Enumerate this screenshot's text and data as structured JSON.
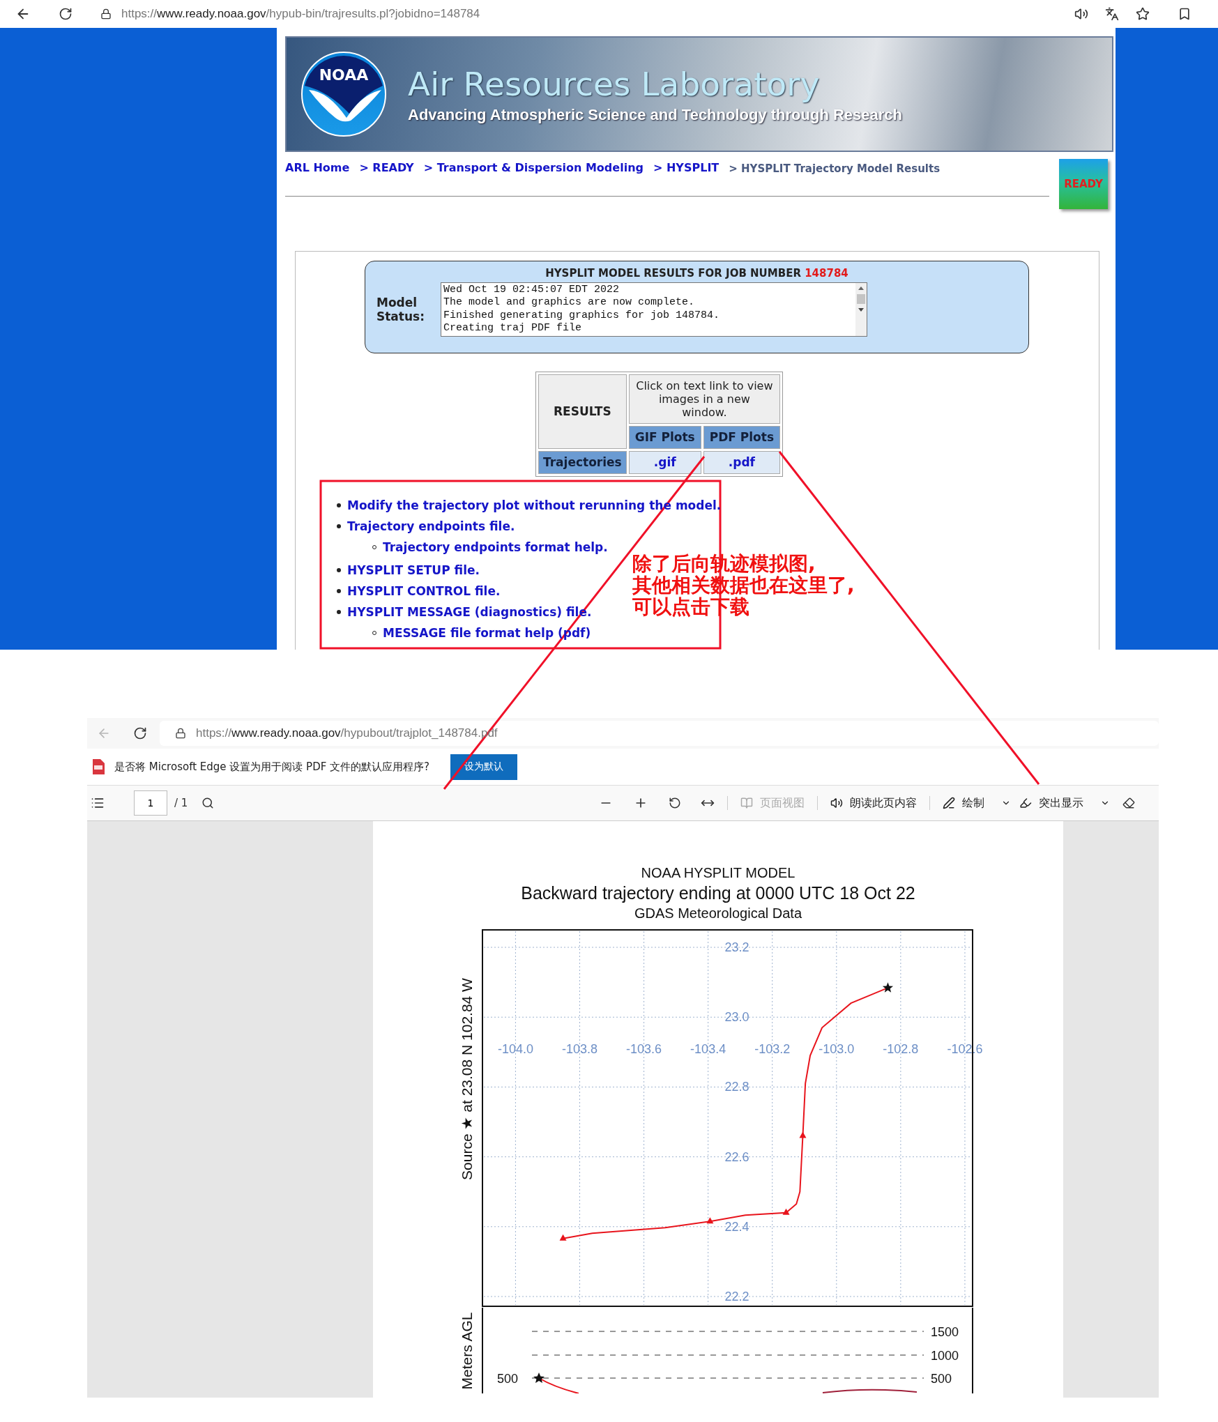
{
  "top_browser": {
    "url_prefix": "https://",
    "url_domain": "www.ready.noaa.gov",
    "url_path": "/hypub-bin/trajresults.pl?jobidno=148784"
  },
  "banner": {
    "logo_text": "NOAA",
    "title": "Air Resources Laboratory",
    "subtitle": "Advancing Atmospheric Science and Technology through Research"
  },
  "breadcrumbs": [
    {
      "label": "ARL Home",
      "current": false
    },
    {
      "label": "> READY",
      "current": false
    },
    {
      "label": "> Transport & Dispersion Modeling",
      "current": false
    },
    {
      "label": "> HYSPLIT",
      "current": false
    },
    {
      "label": "> HYSPLIT Trajectory Model Results",
      "current": true
    }
  ],
  "ready_logo": {
    "text": "READY"
  },
  "status": {
    "title": "HYSPLIT MODEL RESULTS FOR JOB NUMBER",
    "job_number": "148784",
    "label": "Model Status:",
    "log": "Wed Oct 19 02:45:07 EDT 2022\nThe model and graphics are now complete.\nFinished generating graphics for job 148784.\nCreating traj PDF file"
  },
  "results": {
    "header": "RESULTS",
    "note": "Click on text link to view images in a new window.",
    "columns": [
      "GIF Plots",
      "PDF Plots"
    ],
    "rows": [
      {
        "label": "Trajectories",
        "links": [
          ".gif",
          ".pdf"
        ]
      }
    ]
  },
  "links": [
    {
      "label": "Modify the trajectory plot without rerunning the model."
    },
    {
      "label": "Trajectory endpoints file.",
      "children": [
        {
          "label": "Trajectory endpoints format help."
        }
      ]
    },
    {
      "label": "HYSPLIT SETUP file."
    },
    {
      "label": "HYSPLIT CONTROL file."
    },
    {
      "label": "HYSPLIT MESSAGE (diagnostics) file.",
      "children": [
        {
          "label": "MESSAGE file format help (pdf)"
        }
      ]
    }
  ],
  "annotation": {
    "text": "除了后向轨迹模拟图,\n其他相关数据也在这里了,\n可以点击下载"
  },
  "pdf_viewer": {
    "url_prefix": "https://",
    "url_domain": "www.ready.noaa.gov",
    "url_path": "/hypubout/trajplot_148784.pdf",
    "prompt": "是否将 Microsoft Edge 设置为用于阅读 PDF 文件的默认应用程序?",
    "prompt_button": "设为默认",
    "page": "1",
    "page_total": "/ 1",
    "tools": [
      {
        "kind": "page_view",
        "label": "页面视图",
        "disabled": true,
        "dropdown": false
      },
      {
        "kind": "read_aloud",
        "label": "朗读此页内容",
        "disabled": false,
        "dropdown": false
      },
      {
        "kind": "draw",
        "label": "绘制",
        "disabled": false,
        "dropdown": true
      },
      {
        "kind": "highlight",
        "label": "突出显示",
        "disabled": false,
        "dropdown": true
      }
    ]
  },
  "plot": {
    "titles": [
      "NOAA HYSPLIT MODEL",
      "Backward trajectory ending at 0000 UTC 18 Oct 22",
      "GDAS Meteorological Data"
    ],
    "chart_data": {
      "type": "line",
      "ylabel": "Source ★ at 23.08 N 102.84 W",
      "x": [
        -102.84,
        -102.955,
        -103.045,
        -103.082,
        -103.097,
        -103.105,
        -103.114,
        -103.125,
        -103.157,
        -103.284,
        -103.394,
        -103.534,
        -103.761,
        -103.852
      ],
      "grid": true,
      "series": [
        {
          "color": "#e8141c",
          "values": [
            23.084,
            23.04,
            22.97,
            22.89,
            22.81,
            22.66,
            22.5,
            22.465,
            22.44,
            22.433,
            22.415,
            22.397,
            22.381,
            22.366
          ]
        }
      ],
      "xlim": [
        -104.103,
        -102.576
      ],
      "ylim": [
        22.172,
        23.25
      ],
      "xticks": [
        {
          "value": -104,
          "label": "-104.0"
        },
        {
          "value": -103.8,
          "label": "-103.8"
        },
        {
          "value": -103.6,
          "label": "-103.6"
        },
        {
          "value": -103.4,
          "label": "-103.4"
        },
        {
          "value": -103.2,
          "label": "-103.2"
        },
        {
          "value": -103,
          "label": "-103.0"
        },
        {
          "value": -102.8,
          "label": "-102.8"
        },
        {
          "value": -102.6,
          "label": "-102.6"
        }
      ],
      "yticks": [
        {
          "value": 23.2,
          "label": "23.2"
        },
        {
          "value": 23,
          "label": "23.0"
        },
        {
          "value": 22.8,
          "label": "22.8"
        },
        {
          "value": 22.6,
          "label": "22.6"
        },
        {
          "value": 22.4,
          "label": "22.4"
        },
        {
          "value": 22.2,
          "label": "22.2"
        }
      ]
    },
    "height_panel": {
      "ylabel": "Meters AGL",
      "right_ticks": [
        "1500",
        "1000",
        "500"
      ],
      "left_tick": "500"
    }
  }
}
